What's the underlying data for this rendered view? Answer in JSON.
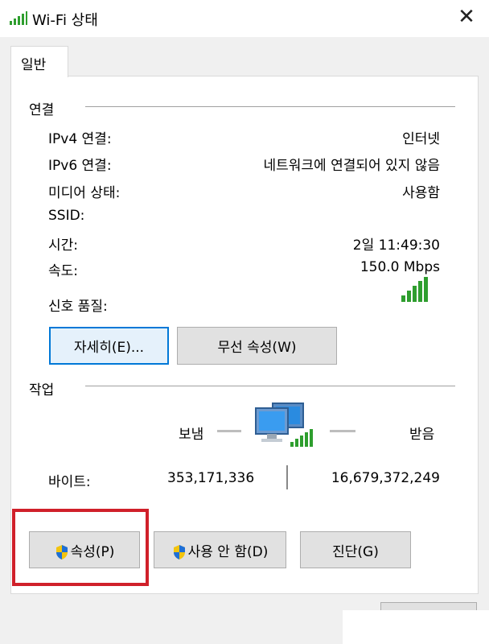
{
  "window": {
    "title": "Wi-Fi 상태",
    "title_icon": "wifi-signal-icon",
    "close_icon": "close-icon",
    "close_glyph": "✕"
  },
  "tabs": [
    {
      "label": "일반"
    }
  ],
  "connection": {
    "section_title": "연결",
    "rows": [
      {
        "label": "IPv4 연결:",
        "value": "인터넷"
      },
      {
        "label": "IPv6 연결:",
        "value": "네트워크에 연결되어 있지 않음"
      },
      {
        "label": "미디어 상태:",
        "value": "사용함"
      },
      {
        "label": "SSID:",
        "value": ""
      },
      {
        "label": "시간:",
        "value": "2일 11:49:30"
      },
      {
        "label": "속도:",
        "value": "150.0 Mbps"
      }
    ],
    "signal_label": "신호 품질:",
    "signal_bars": 5,
    "signal_max": 5,
    "details_button": "자세히(E)...",
    "wireless_button": "무선 속성(W)"
  },
  "activity": {
    "section_title": "작업",
    "sent_label": "보냄",
    "received_label": "받음",
    "bytes_label": "바이트:",
    "bytes_sent": "353,171,336",
    "bytes_received": "16,679,372,249",
    "network_icon": "network-computers-icon"
  },
  "actions": {
    "properties_button": "속성(P)",
    "disable_button": "사용 안 함(D)",
    "diagnose_button": "진단(G)",
    "shield_icon": "uac-shield-icon"
  },
  "colors": {
    "accent": "#0078d7",
    "signal_green": "#2e9e2e",
    "highlight_red": "#d0202a",
    "dialog_bg": "#f0f0f0"
  }
}
